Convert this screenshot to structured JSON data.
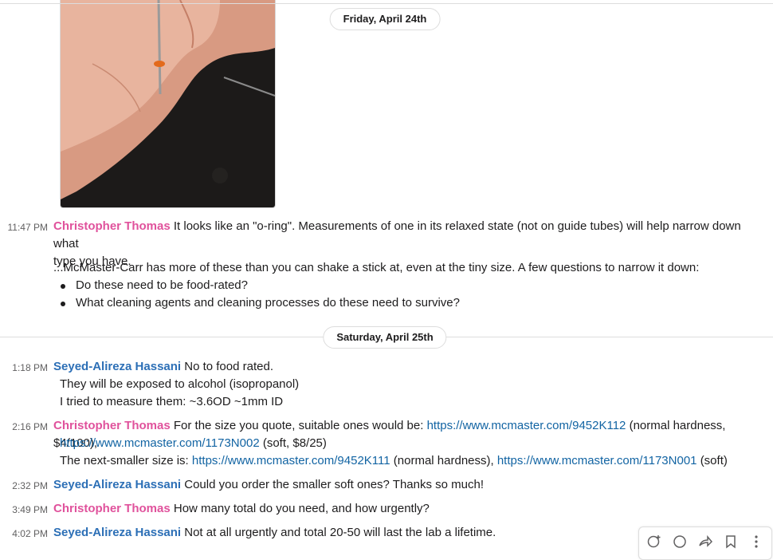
{
  "dates": {
    "friday": "Friday, April 24th",
    "saturday": "Saturday, April 25th"
  },
  "messages": [
    {
      "time": "11:47 PM",
      "author": "Christopher Thomas",
      "text": "It looks like an \"o-ring\". Measurements of one in its relaxed state (not on guide tubes) will help narrow down what",
      "text2": "type you have.",
      "para": "...McMaster-Carr has more of these than you can shake a stick at, even at the tiny size. A few questions to narrow it down:",
      "bullets": [
        "Do these need to be food-rated?",
        "What cleaning agents and cleaning processes do these need to survive?"
      ]
    },
    {
      "time": "1:18 PM",
      "author": "Seyed-Alireza Hassani",
      "text": "No to food rated.",
      "lines": [
        "They will be exposed to alcohol (isopropanol)",
        "I tried to measure them: ~3.6OD ~1mm ID"
      ]
    },
    {
      "time": "2:16 PM",
      "author": "Christopher Thomas",
      "text": "For the size you quote, suitable ones would be:",
      "link1": "https://www.mcmaster.com/9452K112",
      "after1": "(normal hardness, $4/100),",
      "link2": "https://www.mcmaster.com/1173N002",
      "after2": "(soft, $8/25)",
      "line3_pre": "The next-smaller size is:",
      "link3": "https://www.mcmaster.com/9452K111",
      "after3": "(normal hardness),",
      "link4": "https://www.mcmaster.com/1173N001",
      "after4": "(soft)"
    },
    {
      "time": "2:32 PM",
      "author": "Seyed-Alireza Hassani",
      "text": "Could you order the smaller soft ones? Thanks so much!"
    },
    {
      "time": "3:49 PM",
      "author": "Christopher Thomas",
      "text": "How many total do you need, and how urgently?"
    },
    {
      "time": "4:02 PM",
      "author": "Seyed-Alireza Hassani",
      "text": "Not at all urgently and total 20-50 will last the lab a lifetime."
    }
  ],
  "toolbar_icons": [
    "add-reaction-icon",
    "reply-in-thread-icon",
    "share-icon",
    "bookmark-icon",
    "more-actions-icon"
  ],
  "colors": {
    "christopher": "#e0529c",
    "seyed": "#2c6fb6",
    "link": "#1264a3"
  }
}
